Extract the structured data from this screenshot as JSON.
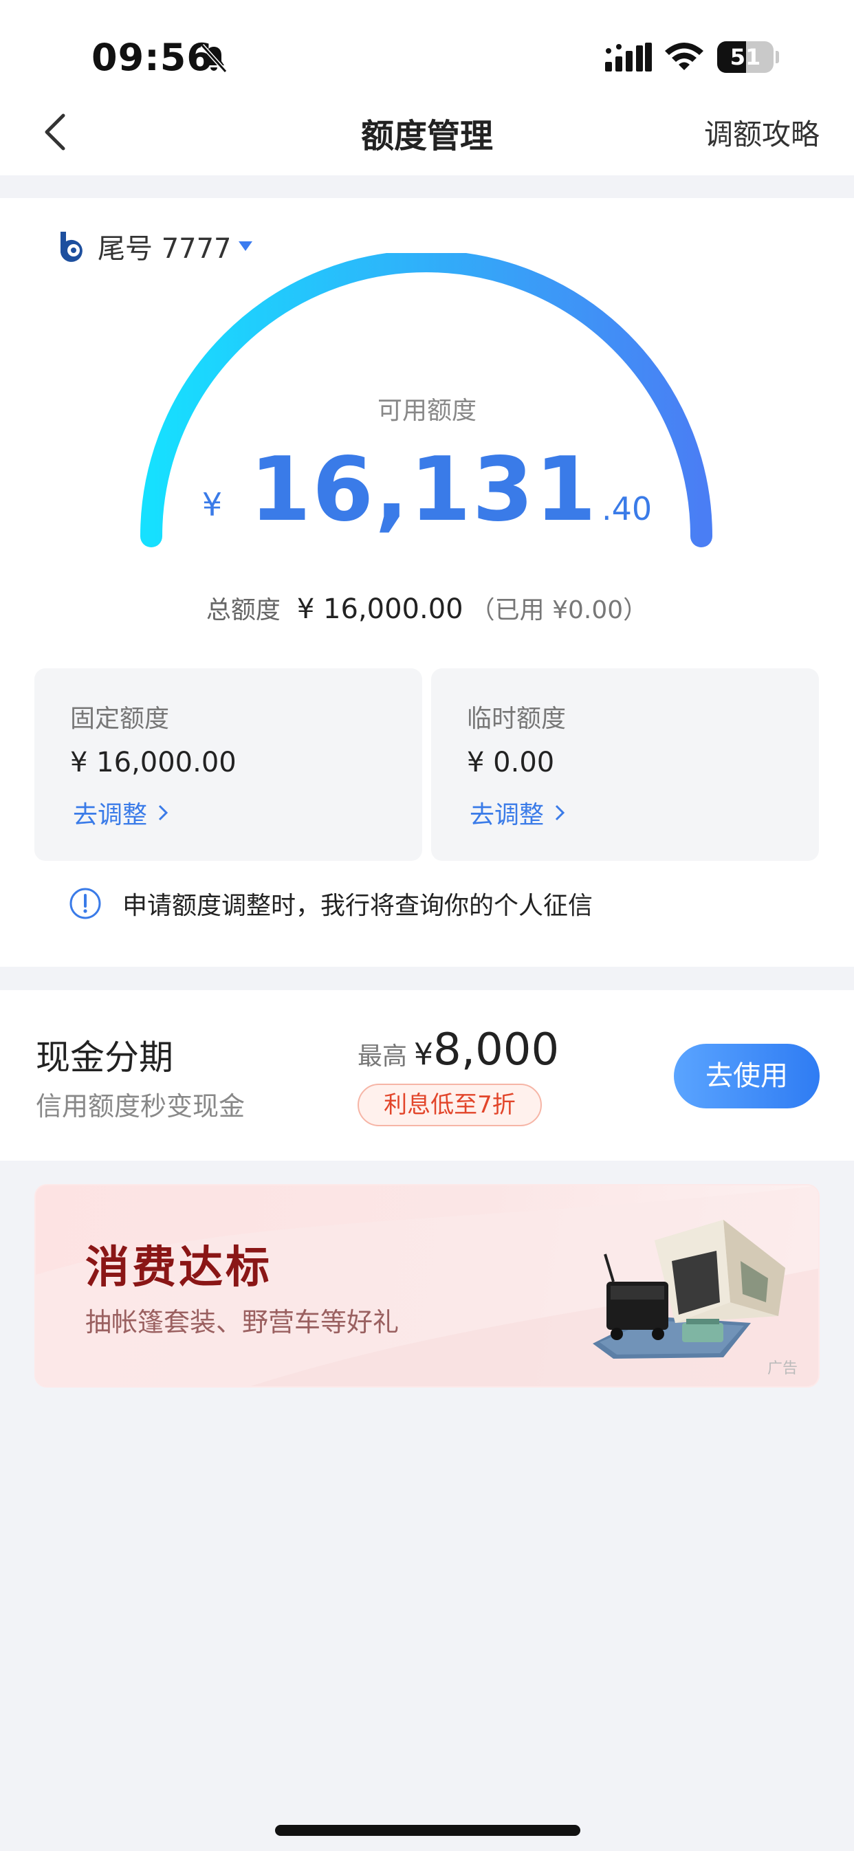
{
  "status_bar": {
    "time": "09:56",
    "battery": "51",
    "battery_level": 0.51
  },
  "nav": {
    "title": "额度管理",
    "right_link": "调额攻略"
  },
  "account": {
    "label": "尾号 7777"
  },
  "quota": {
    "available_label": "可用额度",
    "currency": "¥",
    "available_int": "16,131",
    "available_dec": ".40",
    "total_label": "总额度",
    "total_value": "¥ 16,000.00",
    "used_text": "（已用 ¥0.00）"
  },
  "fixed": {
    "label": "固定额度",
    "value": "¥ 16,000.00",
    "link": "去调整"
  },
  "temp": {
    "label": "临时额度",
    "value": "¥ 0.00",
    "link": "去调整"
  },
  "notice": {
    "text": "申请额度调整时，我行将查询你的个人征信"
  },
  "cash": {
    "title": "现金分期",
    "subtitle": "信用额度秒变现金",
    "max_label": "最高",
    "max_currency": "¥",
    "max_value": "8,000",
    "badge": "利息低至7折",
    "button": "去使用"
  },
  "banner": {
    "title": "消费达标",
    "subtitle": "抽帐篷套装、野营车等好礼",
    "ad_tag": "广告"
  },
  "colors": {
    "accent": "#3a7be8",
    "gauge_start": "#16e0ff",
    "gauge_end": "#4a7ef4",
    "badge_red": "#e2452a"
  },
  "icons": [
    "bell-slash-icon",
    "cellular-signal-icon",
    "wifi-icon",
    "battery-icon",
    "back-arrow-icon",
    "bank-logo-icon",
    "caret-down-icon",
    "chevron-right-icon",
    "info-icon"
  ]
}
